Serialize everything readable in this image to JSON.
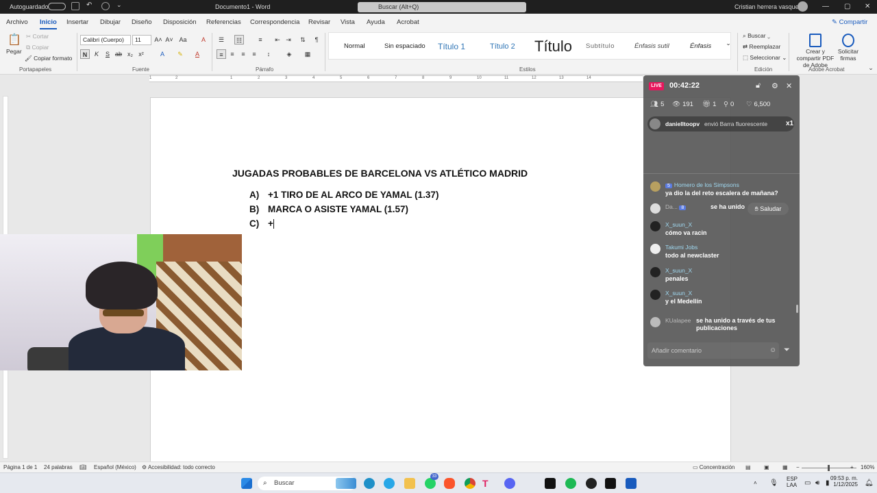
{
  "titlebar": {
    "autosave": "Autoguardado",
    "doc_title": "Documento1 - Word",
    "search": "Buscar (Alt+Q)",
    "user": "Cristian herrera vasquez"
  },
  "menu": {
    "tabs": [
      "Archivo",
      "Inicio",
      "Insertar",
      "Dibujar",
      "Diseño",
      "Disposición",
      "Referencias",
      "Correspondencia",
      "Revisar",
      "Vista",
      "Ayuda",
      "Acrobat"
    ],
    "active": "Inicio",
    "share": "Compartir"
  },
  "ribbon": {
    "clipboard": {
      "paste": "Pegar",
      "cut": "Cortar",
      "copy": "Copiar",
      "format_painter": "Copiar formato",
      "group": "Portapapeles"
    },
    "font": {
      "name": "Calibri (Cuerpo)",
      "size": "11",
      "group": "Fuente"
    },
    "paragraph": {
      "group": "Párrafo"
    },
    "styles": {
      "items": [
        "Normal",
        "Sin espaciado",
        "Título 1",
        "Título 2",
        "Título",
        "Subtítulo",
        "Énfasis sutil",
        "Énfasis"
      ],
      "group": "Estilos"
    },
    "editing": {
      "find": "Buscar",
      "replace": "Reemplazar",
      "select": "Seleccionar",
      "group": "Edición"
    },
    "acrobat": {
      "create": "Crear y compartir PDF de Adobe",
      "sign": "Solicitar firmas",
      "group": "Adobe Acrobat"
    }
  },
  "ruler": {
    "ticks": [
      "1",
      "2",
      "1",
      "2",
      "3",
      "4",
      "5",
      "6",
      "7",
      "8",
      "9",
      "10",
      "11",
      "12",
      "13",
      "14"
    ]
  },
  "document": {
    "heading": "JUGADAS PROBABLES DE BARCELONA VS ATLÉTICO MADRID",
    "items": [
      {
        "letter": "A)",
        "text": "+1 TIRO DE AL ARCO DE YAMAL (1.37)"
      },
      {
        "letter": "B)",
        "text": "MARCA O ASISTE YAMAL (1.57)"
      },
      {
        "letter": "C)",
        "text": "+"
      }
    ]
  },
  "live": {
    "badge": "LIVE",
    "timer": "00:42:22",
    "stats": {
      "people": "5",
      "viewers": "191",
      "gifts": "1",
      "shares": "0",
      "likes": "6,500"
    },
    "gift": {
      "user": "danielltoopv",
      "action": "envió Barra fluorescente",
      "count": "x1"
    },
    "comments": [
      {
        "user": "Homero de los Simpsons",
        "level": "5",
        "msg": "ya dio la del reto escalera de mañana?"
      },
      {
        "user": "Da...",
        "level": "8",
        "msg": "se ha unido",
        "button": "Saludar"
      },
      {
        "user": "X_suun_X",
        "msg": "cómo va racin"
      },
      {
        "user": "Takumi Jobs",
        "msg": "todo al newclaster"
      },
      {
        "user": "X_suun_X",
        "msg": "penales"
      },
      {
        "user": "X_suun_X",
        "msg": "y el Medellín"
      },
      {
        "user": "KUalapee",
        "msg": "se ha unido a través de tus publicaciones"
      }
    ],
    "input_placeholder": "Añadir comentario"
  },
  "statusbar": {
    "page": "Página 1 de 1",
    "words": "24 palabras",
    "language": "Español (México)",
    "accessibility": "Accesibilidad: todo correcto",
    "focus": "Concentración",
    "zoom": "160%"
  },
  "taskbar": {
    "search": "Buscar",
    "lang": "ESP",
    "lang2": "LAA",
    "time": "09:53 p. m.",
    "date": "1/12/2025",
    "badge": "33"
  },
  "colors": {
    "accent": "#185abd",
    "live_badge": "#e8175d"
  }
}
